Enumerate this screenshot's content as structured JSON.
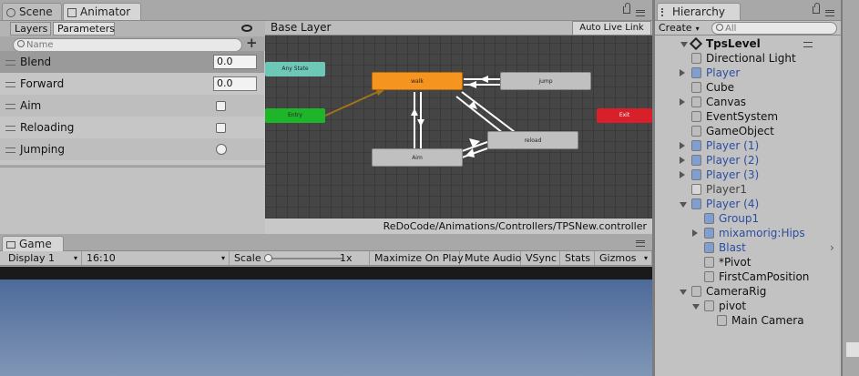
{
  "top_tabs": {
    "scene": "Scene",
    "animator": "Animator"
  },
  "animator": {
    "layers_tab": "Layers",
    "parameters_tab": "Parameters",
    "search_placeholder": "Name",
    "add_label": "+",
    "breadcrumb": "Base Layer",
    "auto_live_link": "Auto Live Link",
    "path": "ReDoCode/Animations/Controllers/TPSNew.controller",
    "parameters": [
      {
        "name": "Blend",
        "type": "float",
        "value": "0.0"
      },
      {
        "name": "Forward",
        "type": "float",
        "value": "0.0"
      },
      {
        "name": "Aim",
        "type": "bool"
      },
      {
        "name": "Reloading",
        "type": "bool"
      },
      {
        "name": "Jumping",
        "type": "trigger"
      }
    ],
    "states": {
      "any_state": "Any State",
      "entry": "Entry",
      "exit": "Exit",
      "walk": "walk",
      "jump": "jump",
      "aim": "Aim",
      "reload": "reload"
    }
  },
  "game": {
    "tab": "Game",
    "display": "Display 1",
    "aspect": "16:10",
    "scale_label": "Scale",
    "scale_value": "1x",
    "maximize": "Maximize On Play",
    "mute": "Mute Audio",
    "vsync": "VSync",
    "stats": "Stats",
    "gizmos": "Gizmos"
  },
  "hierarchy": {
    "tab": "Hierarchy",
    "create": "Create",
    "search_placeholder": "All",
    "scene_name": "TpsLevel",
    "items": [
      {
        "label": "Directional Light",
        "depth": 1,
        "arrow": "none",
        "style": "normal"
      },
      {
        "label": "Player",
        "depth": 1,
        "arrow": "right",
        "style": "prefab"
      },
      {
        "label": "Cube",
        "depth": 1,
        "arrow": "none",
        "style": "normal"
      },
      {
        "label": "Canvas",
        "depth": 1,
        "arrow": "right",
        "style": "normal"
      },
      {
        "label": "EventSystem",
        "depth": 1,
        "arrow": "none",
        "style": "normal"
      },
      {
        "label": "GameObject",
        "depth": 1,
        "arrow": "none",
        "style": "normal"
      },
      {
        "label": "Player (1)",
        "depth": 1,
        "arrow": "right",
        "style": "prefab"
      },
      {
        "label": "Player (2)",
        "depth": 1,
        "arrow": "right",
        "style": "prefab"
      },
      {
        "label": "Player (3)",
        "depth": 1,
        "arrow": "right",
        "style": "prefab"
      },
      {
        "label": "Player1",
        "depth": 1,
        "arrow": "none",
        "style": "inactive"
      },
      {
        "label": "Player (4)",
        "depth": 1,
        "arrow": "down",
        "style": "prefab"
      },
      {
        "label": "Group1",
        "depth": 2,
        "arrow": "none",
        "style": "prefab"
      },
      {
        "label": "mixamorig:Hips",
        "depth": 2,
        "arrow": "right",
        "style": "prefab"
      },
      {
        "label": "Blast",
        "depth": 2,
        "arrow": "none",
        "style": "prefab"
      },
      {
        "label": "*Pivot",
        "depth": 2,
        "arrow": "none",
        "style": "normal"
      },
      {
        "label": "FirstCamPosition",
        "depth": 2,
        "arrow": "none",
        "style": "normal"
      },
      {
        "label": "CameraRig",
        "depth": 1,
        "arrow": "down",
        "style": "normal"
      },
      {
        "label": "pivot",
        "depth": 2,
        "arrow": "down",
        "style": "normal"
      },
      {
        "label": "Main Camera",
        "depth": 3,
        "arrow": "none",
        "style": "normal"
      }
    ]
  },
  "colors": {
    "walk": "#f5941f",
    "any_state": "#6ec8b8",
    "entry": "#1fb52a",
    "exit": "#d8202a",
    "state_grey": "#c0c0c0",
    "prefab_text": "#2a4ea0",
    "sky_top": "#4d6a9a",
    "sky_bottom": "#8096b6"
  }
}
